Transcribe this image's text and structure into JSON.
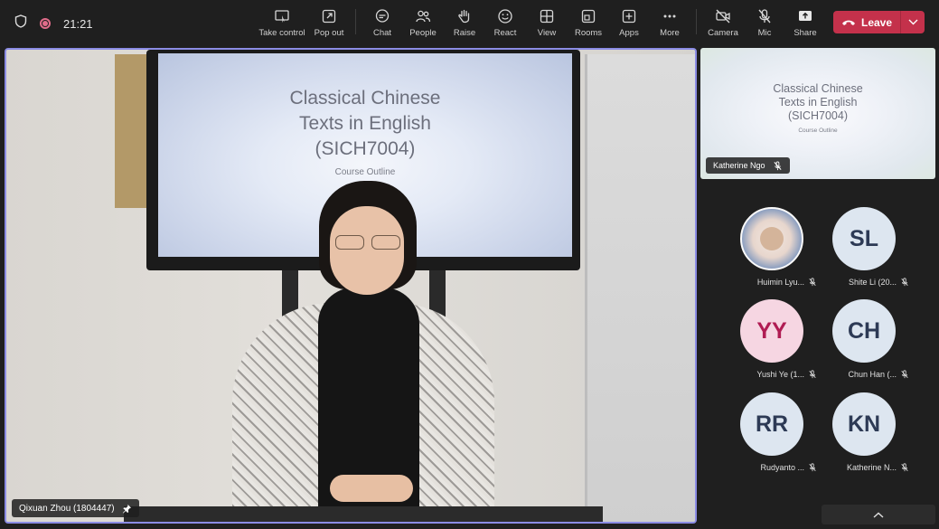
{
  "status": {
    "time": "21:21"
  },
  "toolbar": {
    "items": [
      {
        "label": "Take control"
      },
      {
        "label": "Pop out"
      },
      {
        "label": "Chat"
      },
      {
        "label": "People"
      },
      {
        "label": "Raise"
      },
      {
        "label": "React"
      },
      {
        "label": "View"
      },
      {
        "label": "Rooms"
      },
      {
        "label": "Apps"
      },
      {
        "label": "More"
      },
      {
        "label": "Camera"
      },
      {
        "label": "Mic"
      },
      {
        "label": "Share"
      }
    ],
    "leave_label": "Leave"
  },
  "main_video": {
    "slide_title_1": "Classical Chinese",
    "slide_title_2": "Texts in English",
    "slide_title_3": "(SICH7004)",
    "slide_subtitle": "Course Outline",
    "participant_name": "Qixuan Zhou (1804447)"
  },
  "shared_screen": {
    "slide_title_1": "Classical Chinese",
    "slide_title_2": "Texts in English",
    "slide_title_3": "(SICH7004)",
    "slide_subtitle": "Course Outline",
    "presenter_name": "Katherine Ngo"
  },
  "participants": [
    {
      "initials": "",
      "name": "Huimin Lyu..."
    },
    {
      "initials": "SL",
      "name": "Shite Li (20..."
    },
    {
      "initials": "YY",
      "name": "Yushi Ye (1..."
    },
    {
      "initials": "CH",
      "name": "Chun Han (..."
    },
    {
      "initials": "RR",
      "name": "Rudyanto ..."
    },
    {
      "initials": "KN",
      "name": "Katherine N..."
    }
  ],
  "colors": {
    "accent": "#8b8ce4",
    "leave": "#c4314b",
    "recording": "#e06c8a"
  }
}
